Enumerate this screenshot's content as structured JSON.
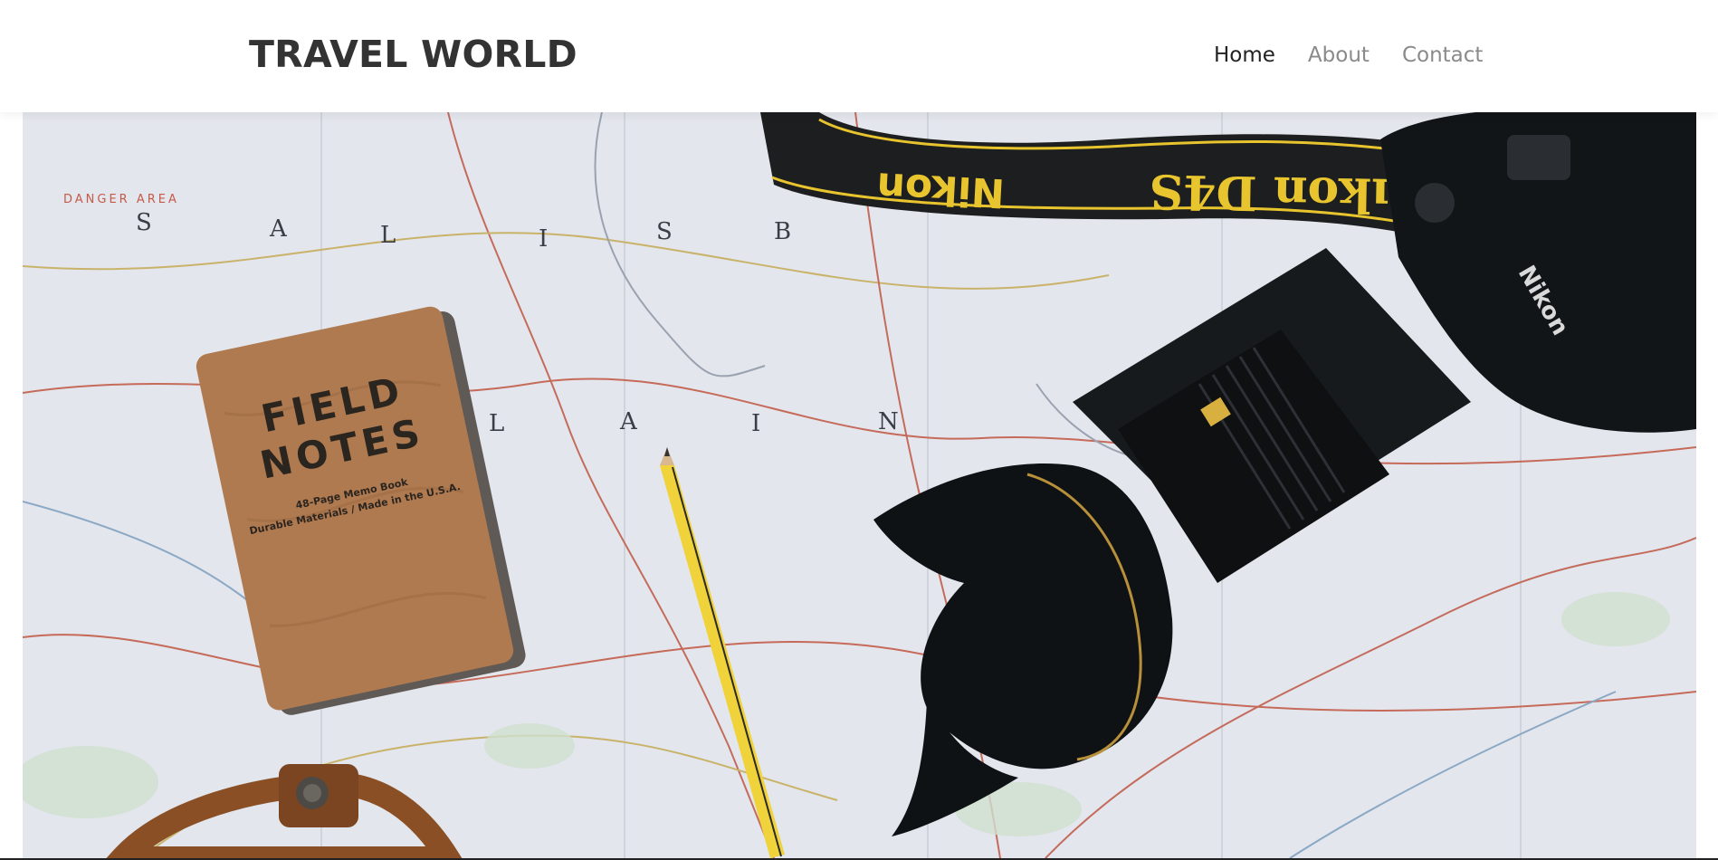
{
  "header": {
    "brand": "TRAVEL WORLD",
    "nav": [
      {
        "label": "Home",
        "active": true
      },
      {
        "label": "About",
        "active": false
      },
      {
        "label": "Contact",
        "active": false
      }
    ]
  },
  "hero": {
    "strap_text_1": "Nikon",
    "strap_text_2": "ıkon D4S",
    "notebook_title_line1": "FIELD",
    "notebook_title_line2": "NOTES",
    "notebook_sub1": "48-Page Memo Book",
    "notebook_sub2": "Durable Materials / Made in the U.S.A.",
    "map_letters_top": [
      "S",
      "A",
      "L",
      "I",
      "S",
      "B"
    ],
    "map_letters_mid": [
      "L",
      "A",
      "I",
      "N"
    ],
    "map_danger": "DANGER AREA",
    "camera_brand": "Nikon"
  },
  "colors": {
    "map_bg": "#e3e6ec",
    "strap": "#1d1e1f",
    "strap_text": "#e8c52e",
    "notebook": "#b07a50",
    "camera": "#121518",
    "pencil": "#f0d23a"
  }
}
